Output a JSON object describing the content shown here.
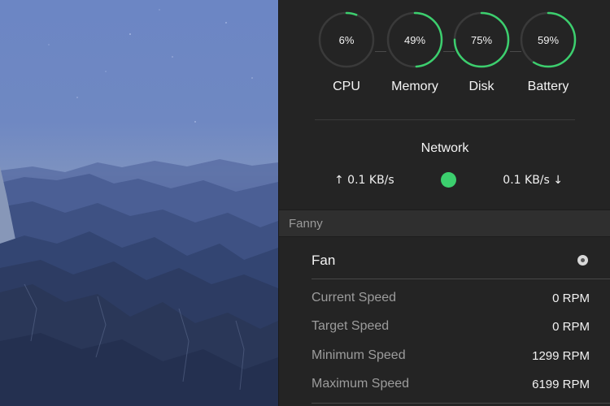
{
  "gauges": [
    {
      "label": "CPU",
      "value_text": "6%",
      "fraction": 0.06
    },
    {
      "label": "Memory",
      "value_text": "49%",
      "fraction": 0.49
    },
    {
      "label": "Disk",
      "value_text": "75%",
      "fraction": 0.75
    },
    {
      "label": "Battery",
      "value_text": "59%",
      "fraction": 0.59
    }
  ],
  "network": {
    "title": "Network",
    "upload": "↑ 0.1 KB/s",
    "download": "0.1 KB/s ↓"
  },
  "fan_section": {
    "header": "Fanny",
    "fan_title": "Fan",
    "rows": [
      {
        "label": "Current Speed",
        "value": "0 RPM"
      },
      {
        "label": "Target Speed",
        "value": "0 RPM"
      },
      {
        "label": "Minimum Speed",
        "value": "1299 RPM"
      },
      {
        "label": "Maximum Speed",
        "value": "6199 RPM"
      }
    ]
  },
  "colors": {
    "accent": "#3ccf6e",
    "track": "#3a3a3a",
    "panel_bg": "#242424"
  },
  "icons": {
    "fan_status": "radio-dot-icon",
    "network_status": "status-dot-icon"
  }
}
